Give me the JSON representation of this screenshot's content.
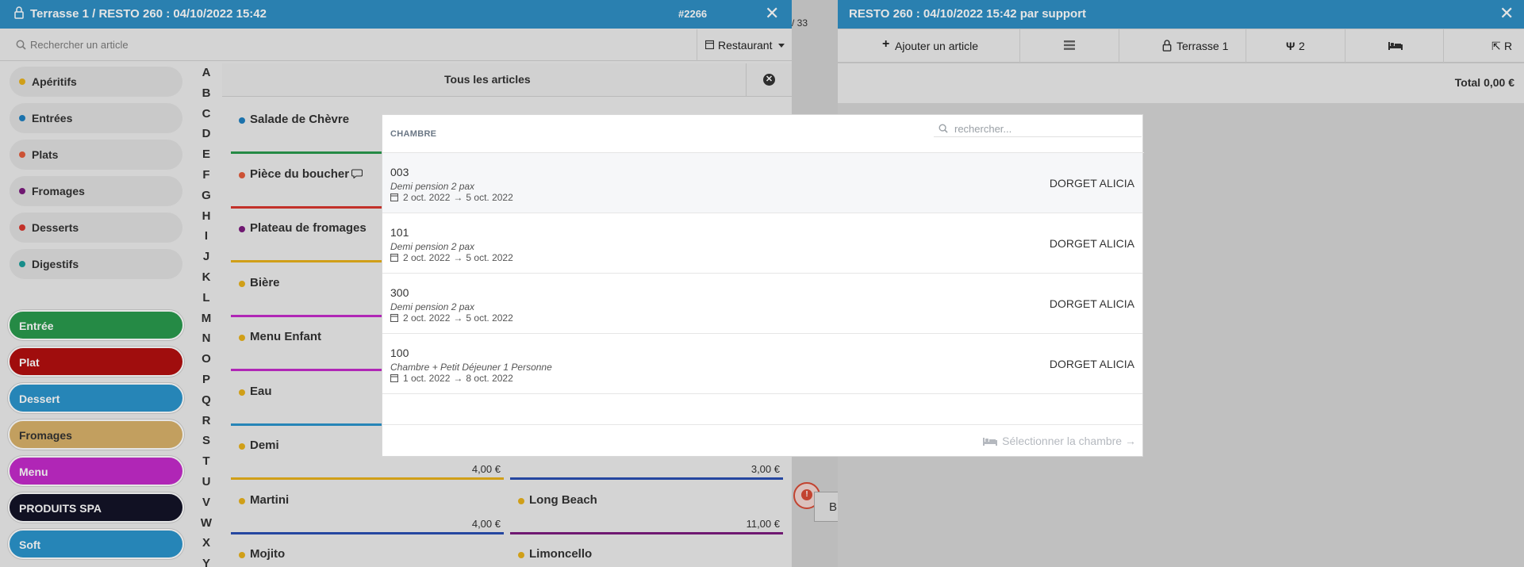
{
  "left_window": {
    "title": "Terrasse 1 / RESTO 260 : 04/10/2022 15:42",
    "order_number": "#2266",
    "close_glyph": "✕",
    "search_placeholder": "Rechercher un article",
    "outlet_label": "Restaurant"
  },
  "categories": [
    {
      "label": "Apéritifs",
      "color": "#e8b21b"
    },
    {
      "label": "Entrées",
      "color": "#1f7fc0"
    },
    {
      "label": "Plats",
      "color": "#e45c3c"
    },
    {
      "label": "Fromages",
      "color": "#7c1b7e"
    },
    {
      "label": "Desserts",
      "color": "#d9372e"
    },
    {
      "label": "Digestifs",
      "color": "#1a9e9a"
    }
  ],
  "course_buttons": [
    {
      "label": "Entrée",
      "color": "#2a9a4d"
    },
    {
      "label": "Plat",
      "color": "#b30f0f"
    },
    {
      "label": "Dessert",
      "color": "#2b95cc"
    },
    {
      "label": "Fromages",
      "color": "#d9b26a",
      "text_color": "#333333"
    },
    {
      "label": "Menu",
      "color": "#c52bcb"
    },
    {
      "label": "PRODUITS SPA",
      "color": "#141428"
    },
    {
      "label": "Soft",
      "color": "#2b95cc"
    }
  ],
  "alphabet": [
    "A",
    "B",
    "C",
    "D",
    "E",
    "F",
    "G",
    "H",
    "I",
    "J",
    "K",
    "L",
    "M",
    "N",
    "O",
    "P",
    "Q",
    "R",
    "S",
    "T",
    "U",
    "V",
    "W",
    "X",
    "Y"
  ],
  "articles_header": "Tous les articles",
  "articles_left": [
    {
      "name": "Salade de Chèvre",
      "price": "",
      "dot": "#1f7fc0",
      "bar": "#2a9a4d"
    },
    {
      "name": "Pièce du boucher",
      "price": "",
      "dot": "#e45c3c",
      "bar": "#d9372e"
    },
    {
      "name": "Plateau de fromages",
      "price": "",
      "dot": "#7c1b7e",
      "bar": "#e8b21b"
    },
    {
      "name": "Bière",
      "price": "",
      "dot": "#e8b21b",
      "bar": "#c52bcb"
    },
    {
      "name": "Menu Enfant",
      "price": "",
      "dot": "#e8b21b",
      "bar": "#c52bcb"
    },
    {
      "name": "Eau",
      "price": "",
      "dot": "#e8b21b",
      "bar": "#2b95cc"
    },
    {
      "name": "Demi",
      "price": "4,00 €",
      "dot": "#e8b21b",
      "bar": "#e8b21b"
    },
    {
      "name": "Martini",
      "price": "4,00 €",
      "dot": "#e8b21b",
      "bar": "#2a4fb3"
    },
    {
      "name": "Mojito",
      "price": "",
      "dot": "#e8b21b",
      "bar": ""
    }
  ],
  "articles_right": [
    {
      "name": "",
      "price": "3,00 €",
      "dot": "",
      "bar": "#2a4fb3"
    },
    {
      "name": "Long Beach",
      "price": "11,00 €",
      "dot": "#e8b21b",
      "bar": "#7c1b7e"
    },
    {
      "name": "Limoncello",
      "price": "",
      "dot": "#e8b21b",
      "bar": ""
    }
  ],
  "middle": {
    "counter": "/ 33",
    "stub_label": "B"
  },
  "right_window": {
    "title": "RESTO 260 : 04/10/2022 15:42 par support",
    "close_glyph": "✕",
    "add_article": "Ajouter un article",
    "table_name": "Terrasse 1",
    "covers": "2",
    "extra": "R",
    "total": "Total 0,00 €"
  },
  "modal": {
    "header": "CHAMBRE",
    "search_placeholder": "rechercher...",
    "rooms": [
      {
        "number": "003",
        "type": "Demi pension 2 pax",
        "start": "2 oct. 2022",
        "end": "5 oct. 2022",
        "guest": "DORGET ALICIA",
        "selected": true
      },
      {
        "number": "101",
        "type": "Demi pension 2 pax",
        "start": "2 oct. 2022",
        "end": "5 oct. 2022",
        "guest": "DORGET ALICIA",
        "selected": false
      },
      {
        "number": "300",
        "type": "Demi pension 2 pax",
        "start": "2 oct. 2022",
        "end": "5 oct. 2022",
        "guest": "DORGET ALICIA",
        "selected": false
      },
      {
        "number": "100",
        "type": "Chambre + Petit Déjeuner 1 Personne",
        "start": "1 oct. 2022",
        "end": "8 oct. 2022",
        "guest": "DORGET ALICIA",
        "selected": false
      }
    ],
    "arrow_glyph": "→",
    "select_button": "Sélectionner la chambre"
  },
  "colors": {
    "titlebar": "#2f8fc4",
    "disabled_text": "#b5b9bf"
  }
}
